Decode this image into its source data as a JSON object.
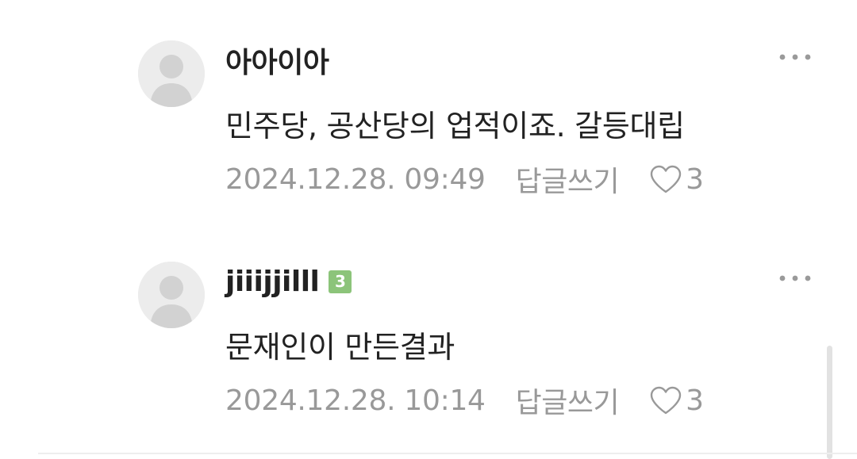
{
  "colors": {
    "username": "#222222",
    "text": "#222222",
    "meta": "#999999",
    "badge": "#8cc47a",
    "avatar_bg": "#ececec",
    "avatar_fg": "#d2d2d2"
  },
  "comments": [
    {
      "username": "아아이아",
      "body": "민주당, 공산당의 업적이죠. 갈등대립",
      "date": "2024.12.28. 09:49",
      "reply_label": "답글쓰기",
      "like_icon": "heart-outline-icon",
      "likes": "3",
      "more_icon": "more-horizontal-icon"
    },
    {
      "username": "jiiijjilll",
      "level_badge": "3",
      "body": "문재인이 만든결과",
      "date": "2024.12.28. 10:14",
      "reply_label": "답글쓰기",
      "like_icon": "heart-outline-icon",
      "likes": "3",
      "more_icon": "more-horizontal-icon"
    }
  ]
}
